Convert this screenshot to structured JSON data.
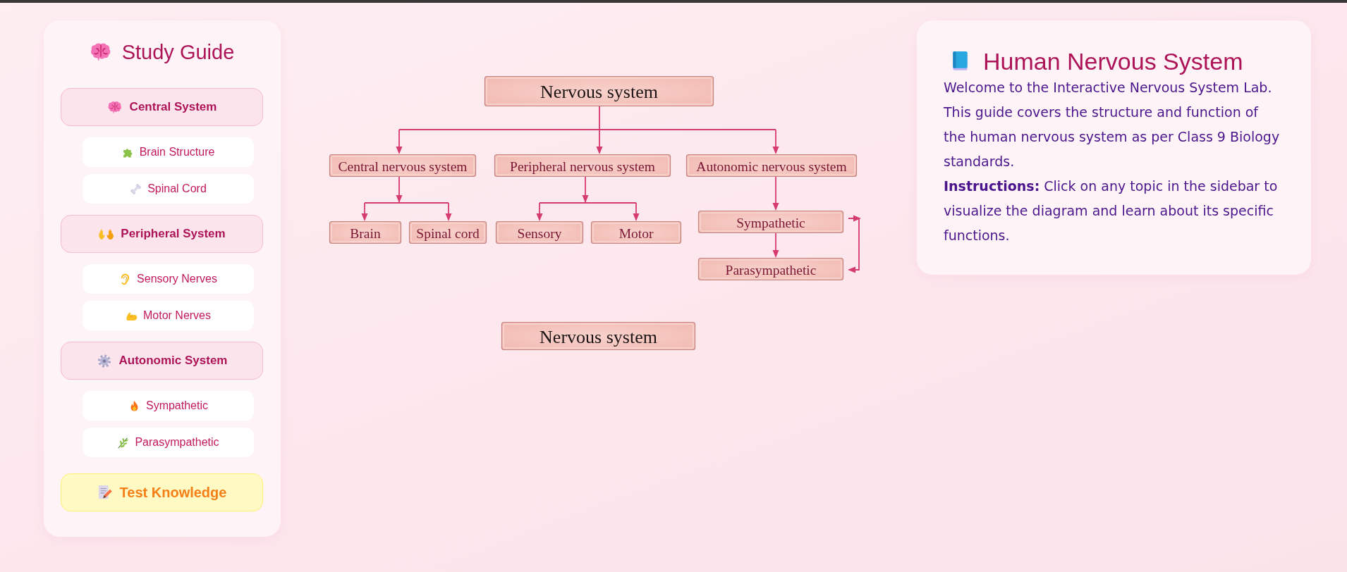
{
  "sidebar": {
    "title": "Study Guide",
    "sections": [
      {
        "label": "Central System",
        "items": [
          {
            "label": "Brain Structure"
          },
          {
            "label": "Spinal Cord"
          }
        ]
      },
      {
        "label": "Peripheral System",
        "items": [
          {
            "label": "Sensory Nerves"
          },
          {
            "label": "Motor Nerves"
          }
        ]
      },
      {
        "label": "Autonomic System",
        "items": [
          {
            "label": "Sympathetic"
          },
          {
            "label": "Parasympathetic"
          }
        ]
      }
    ],
    "quiz_button": "Test Knowledge"
  },
  "diagram": {
    "root": {
      "label": "Nervous system",
      "children": [
        {
          "label": "Central nervous system",
          "children": [
            {
              "label": "Brain"
            },
            {
              "label": "Spinal cord"
            }
          ]
        },
        {
          "label": "Peripheral nervous system",
          "children": [
            {
              "label": "Sensory"
            },
            {
              "label": "Motor"
            }
          ]
        },
        {
          "label": "Autonomic nervous system",
          "children": [
            {
              "label": "Sympathetic",
              "children": [
                {
                  "label": "Parasympathetic"
                }
              ]
            }
          ]
        }
      ]
    },
    "caption": "Nervous system"
  },
  "info": {
    "title": "Human Nervous System",
    "paragraphs": [
      "Welcome to the Interactive Nervous System Lab. This guide covers the structure and function of the human nervous system as per Class 9 Biology standards.",
      "**Instructions:** Click on any topic in the sidebar to visualize the diagram and learn about its specific functions."
    ]
  }
}
